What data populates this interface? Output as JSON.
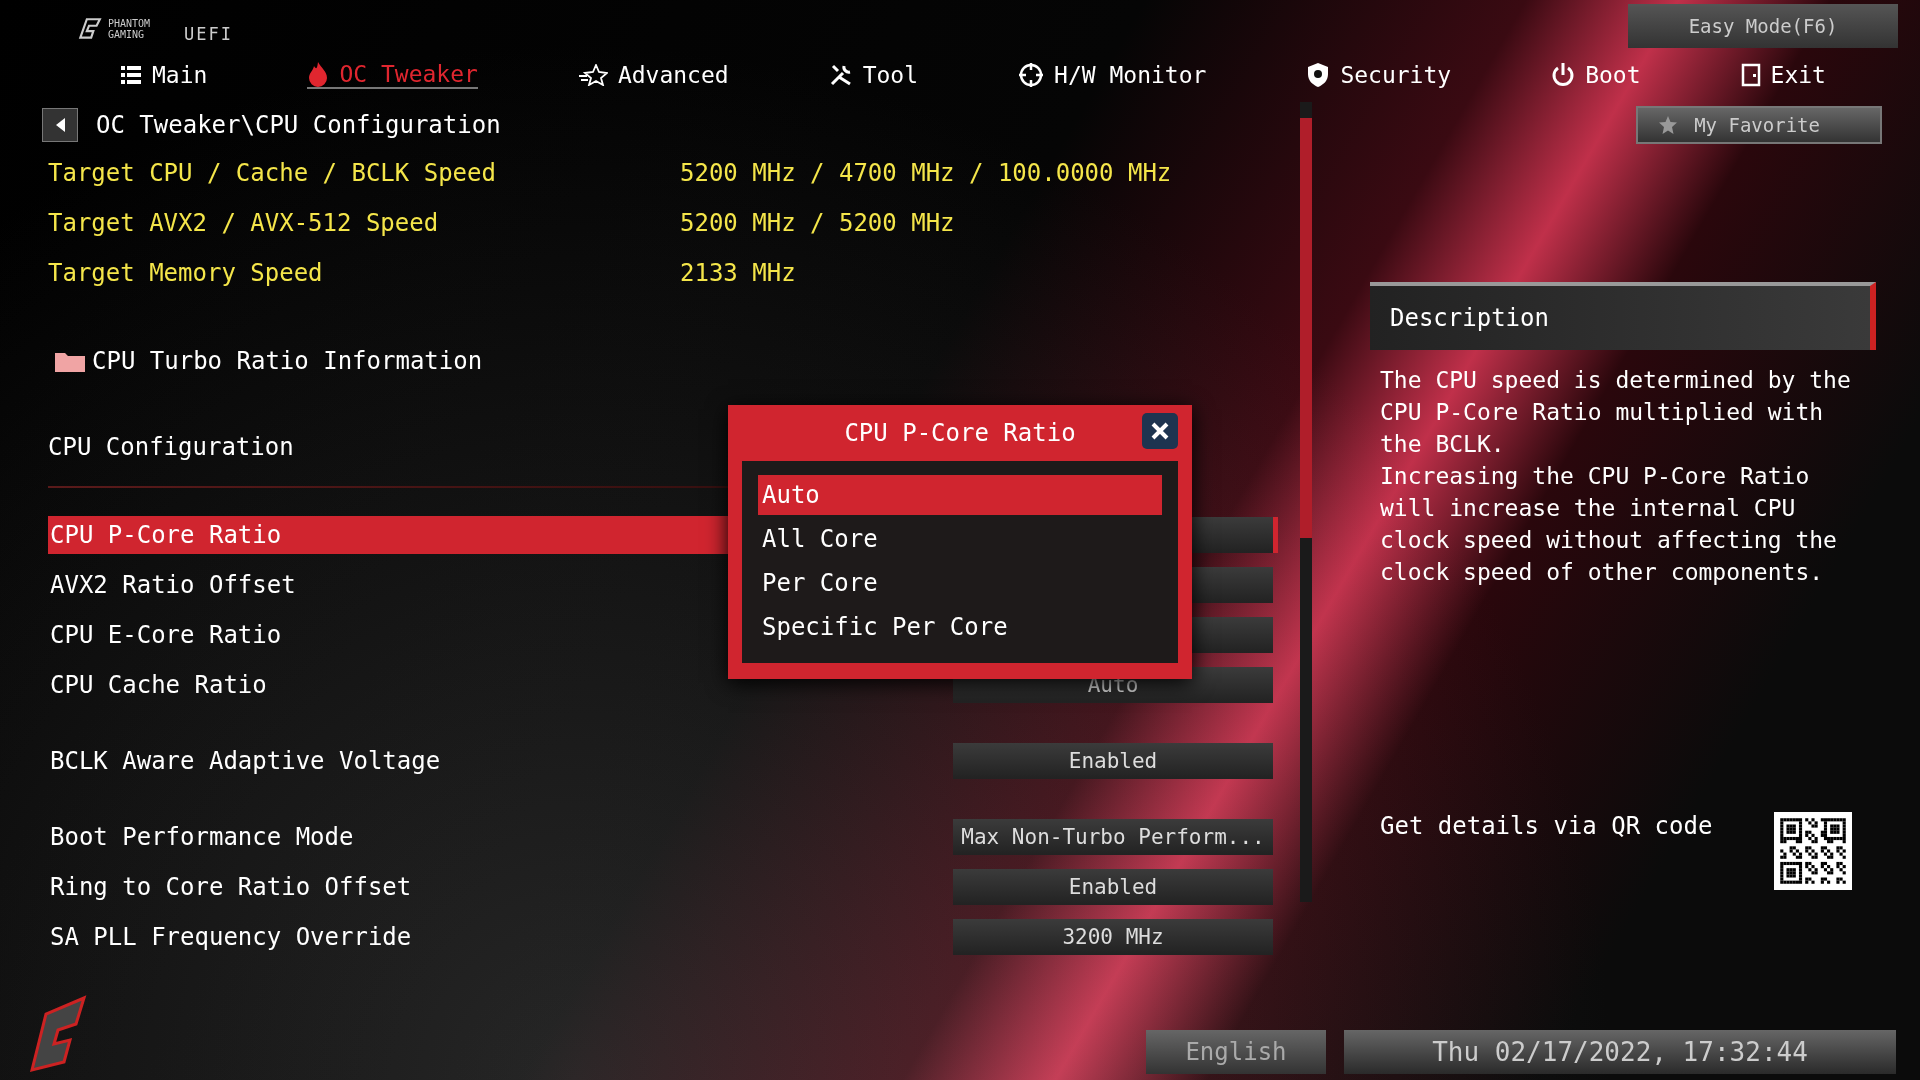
{
  "brand": {
    "name": "PHANTOM GAMING",
    "suffix": "UEFI"
  },
  "top_buttons": {
    "easy_mode": "Easy Mode(F6)",
    "favorite": "My Favorite"
  },
  "tabs": [
    {
      "label": "Main",
      "selected": false
    },
    {
      "label": "OC Tweaker",
      "selected": true
    },
    {
      "label": "Advanced",
      "selected": false
    },
    {
      "label": "Tool",
      "selected": false
    },
    {
      "label": "H/W Monitor",
      "selected": false
    },
    {
      "label": "Security",
      "selected": false
    },
    {
      "label": "Boot",
      "selected": false
    },
    {
      "label": "Exit",
      "selected": false
    }
  ],
  "breadcrumb": "OC Tweaker\\CPU Configuration",
  "info_rows": [
    {
      "label": "Target CPU / Cache / BCLK Speed",
      "value": "5200 MHz / 4700 MHz / 100.0000 MHz"
    },
    {
      "label": "Target AVX2 / AVX-512 Speed",
      "value": "5200 MHz / 5200 MHz"
    },
    {
      "label": "Target Memory Speed",
      "value": "2133 MHz"
    }
  ],
  "submenu": "CPU Turbo Ratio Information",
  "section_title": "CPU Configuration",
  "setting_groups": [
    [
      {
        "label": "CPU P-Core Ratio",
        "selected": true
      },
      {
        "label": "AVX2 Ratio Offset",
        "selected": false
      },
      {
        "label": "CPU E-Core Ratio",
        "selected": false
      },
      {
        "label": "CPU Cache  Ratio",
        "value": "Auto",
        "selected": false
      }
    ],
    [
      {
        "label": "BCLK Aware Adaptive Voltage",
        "value": "Enabled",
        "selected": false
      }
    ],
    [
      {
        "label": "Boot Performance Mode",
        "value": "Max Non-Turbo Perform...",
        "selected": false
      },
      {
        "label": "Ring to Core Ratio Offset",
        "value": "Enabled",
        "selected": false
      },
      {
        "label": "SA PLL Frequency Override",
        "value": "3200 MHz",
        "selected": false
      }
    ]
  ],
  "popup": {
    "title": "CPU P-Core Ratio",
    "options": [
      {
        "label": "Auto",
        "selected": true
      },
      {
        "label": "All Core",
        "selected": false
      },
      {
        "label": "Per Core",
        "selected": false
      },
      {
        "label": "Specific Per Core",
        "selected": false
      }
    ]
  },
  "description": {
    "title": "Description",
    "paragraphs": [
      "The CPU speed is determined by the CPU P-Core Ratio multiplied with the BCLK.",
      "Increasing the CPU P-Core Ratio will increase the internal CPU clock speed without affecting the clock speed of other components."
    ]
  },
  "qr_text": "Get details via QR code",
  "status_bar": {
    "language": "English",
    "datetime": "Thu 02/17/2022, 17:32:44"
  }
}
